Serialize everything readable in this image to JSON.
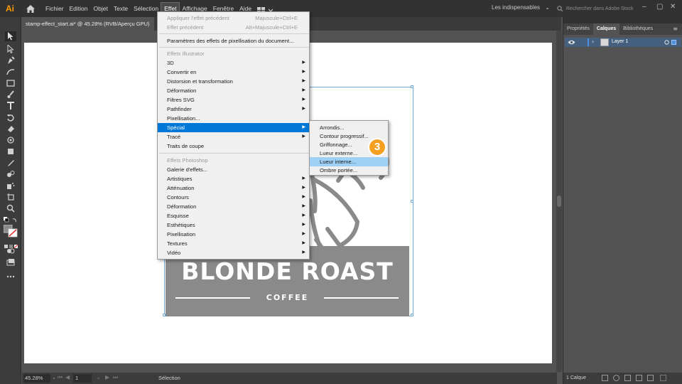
{
  "app": {
    "logo_text": "Ai",
    "brand_color": "#ff9a00"
  },
  "menubar": {
    "items": [
      "Fichier",
      "Edition",
      "Objet",
      "Texte",
      "Sélection",
      "Effet",
      "Affichage",
      "Fenêtre",
      "Aide"
    ],
    "active": "Effet",
    "workspace": "Les indispensables",
    "search_placeholder": "Rechercher dans Adobe Stock"
  },
  "document": {
    "tab_title": "stamp-effect_start.ai* @ 45.28% (RVB/Aperçu GPU)"
  },
  "artwork": {
    "title": "BLONDE ROAST",
    "subtitle": "COFFEE",
    "ink_color": "#8a8a8a"
  },
  "effect_menu": {
    "items": [
      {
        "label": "Appliquer l'effet précédent",
        "shortcut": "Majuscule+Ctrl+E",
        "state": "disabled"
      },
      {
        "label": "Effet précédent",
        "shortcut": "Alt+Majuscule+Ctrl+E",
        "state": "disabled"
      },
      {
        "label": "Paramètres des effets de pixellisation du document..."
      },
      {
        "label": "Effets Illustrator",
        "state": "header"
      },
      {
        "label": "3D",
        "submenu": true
      },
      {
        "label": "Convertir en",
        "submenu": true
      },
      {
        "label": "Distorsion et transformation",
        "submenu": true
      },
      {
        "label": "Déformation",
        "submenu": true
      },
      {
        "label": "Filtres SVG",
        "submenu": true
      },
      {
        "label": "Pathfinder",
        "submenu": true
      },
      {
        "label": "Pixellisation..."
      },
      {
        "label": "Spécial",
        "submenu": true,
        "state": "highlight"
      },
      {
        "label": "Tracé",
        "submenu": true
      },
      {
        "label": "Traits de coupe"
      },
      {
        "label": "Effets Photoshop",
        "state": "header"
      },
      {
        "label": "Galerie d'effets..."
      },
      {
        "label": "Artistiques",
        "submenu": true
      },
      {
        "label": "Atténuation",
        "submenu": true
      },
      {
        "label": "Contours",
        "submenu": true
      },
      {
        "label": "Déformation",
        "submenu": true
      },
      {
        "label": "Esquisse",
        "submenu": true
      },
      {
        "label": "Esthétiques",
        "submenu": true
      },
      {
        "label": "Pixellisation",
        "submenu": true
      },
      {
        "label": "Textures",
        "submenu": true
      },
      {
        "label": "Vidéo",
        "submenu": true
      }
    ]
  },
  "special_submenu": {
    "items": [
      {
        "label": "Arrondis..."
      },
      {
        "label": "Contour progressif..."
      },
      {
        "label": "Griffonnage..."
      },
      {
        "label": "Lueur externe..."
      },
      {
        "label": "Lueur interne...",
        "state": "hover"
      },
      {
        "label": "Ombre portée..."
      }
    ]
  },
  "step_badge": {
    "label": "3",
    "color": "#f5a021"
  },
  "status": {
    "zoom": "45.28%",
    "page": "1",
    "tool": "Sélection"
  },
  "panel": {
    "tabs": [
      "Propriétés",
      "Calques",
      "Bibliothèques"
    ],
    "active_tab": "Calques",
    "layers": [
      {
        "name": "Layer 1",
        "color": "#4f8fdc"
      }
    ],
    "layer_count_label": "1 Calque"
  }
}
